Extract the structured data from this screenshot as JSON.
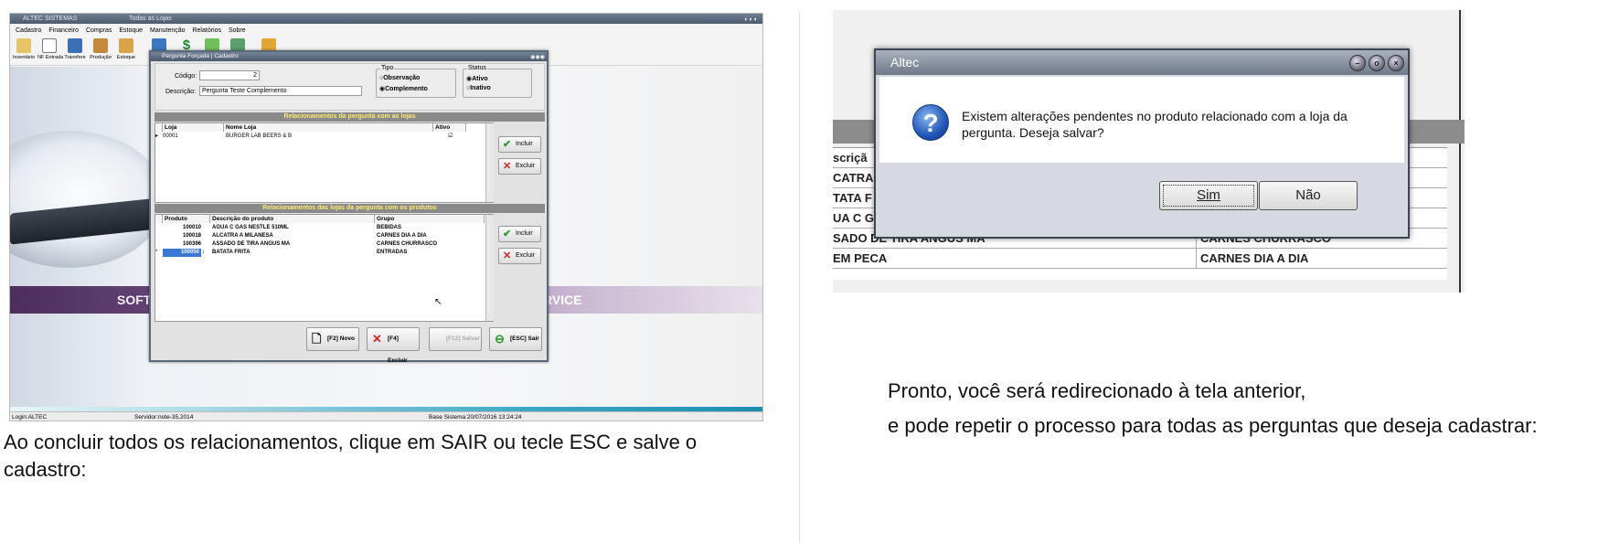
{
  "left_screen": {
    "title": "ALTEC SISTEMAS",
    "subtitle": "Todas as Lojas",
    "menu": [
      "Cadastro",
      "Financeiro",
      "Compras",
      "Estoque",
      "Manutenção",
      "Relatórios",
      "Sobre"
    ],
    "toolbar": [
      "Inventário",
      "NF Entrada",
      "Transfere",
      "Produção",
      "Estoque",
      "",
      "",
      "",
      "",
      ""
    ],
    "banner_left": "SOFT",
    "banner_right": "RVICE",
    "status": {
      "login": "Login:ALTEC",
      "server": "Servidor:note-35,2014",
      "base": "Base Sistema:20/07/2016 13:24:24"
    },
    "dialog": {
      "title": "Pergunta Forçada | Cadastro",
      "codigo_label": "Código:",
      "codigo_value": "2",
      "descricao_label": "Descrição:",
      "descricao_value": "Pergunta Teste Complemento",
      "tipo_label": "Tipo",
      "tipo_options": [
        "Observação",
        "Complemento"
      ],
      "tipo_selected": "Complemento",
      "status_label": "Status",
      "status_options": [
        "Ativo",
        "Inativo"
      ],
      "status_selected": "Ativo",
      "rel_lojas_title": "Relacionamentos da pergunta com as lojas",
      "lojas_headers": [
        "Loja",
        "Nome Loja",
        "Ativo"
      ],
      "lojas_rows": [
        {
          "loja": "00001",
          "nome": "BURGER LAB BEERS & B",
          "ativo": "☑"
        }
      ],
      "rel_produtos_title": "Relacionamentos das lojas da pergunta com os produtos",
      "produtos_headers": [
        "Produto",
        "Descrição do produto",
        "Grupo"
      ],
      "produtos_rows": [
        {
          "produto": "100010",
          "descricao": "AGUA C GAS NESTLE 510ML",
          "grupo": "BEBIDAS"
        },
        {
          "produto": "100018",
          "descricao": "ALCATRA A MILANESA",
          "grupo": "CARNES DIA A DIA"
        },
        {
          "produto": "100396",
          "descricao": "ASSADO DE TIRA ANGUS MA",
          "grupo": "CARNES CHURRASCO"
        },
        {
          "produto": "100050",
          "descricao": "BATATA FRITA",
          "grupo": "ENTRADAS"
        }
      ],
      "btn_incluir": "Incluir",
      "btn_excluir": "Excluir",
      "btn_novo": "[F2] Novo",
      "btn_f4_excluir": "[F4] Excluir",
      "btn_salvar": "[F12] Salvar",
      "btn_sair": "[ESC] Sair"
    }
  },
  "right_screen": {
    "table_col_header": "scriçã",
    "rows": [
      {
        "c1": "CATRA",
        "c2": ""
      },
      {
        "c1": "TATA F",
        "c2": ""
      },
      {
        "c1": "UA C G",
        "c2": ""
      },
      {
        "c1": "SADO DE TIRA ANGUS MA",
        "c2": "CARNES CHURRASCO"
      },
      {
        "c1": "EM PECA",
        "c2": "CARNES DIA A DIA"
      }
    ],
    "message_box": {
      "title": "Altec",
      "text": "Existem alterações pendentes no produto relacionado com a loja da pergunta. Deseja salvar?",
      "yes": "Sim",
      "no": "Não"
    }
  },
  "captions": {
    "left": "Ao concluir todos os relacionamentos, clique em SAIR ou tecle ESC e salve o cadastro:",
    "right_line1": "Pronto, você será redirecionado à tela anterior,",
    "right_line2": "e pode repetir o processo para todas as perguntas que deseja cadastrar:"
  },
  "colors": {
    "band": "#4d2d5c",
    "teal": "#1e8fb0",
    "header_bar": "#8a8a8a",
    "header_text": "#ffeb6e"
  }
}
